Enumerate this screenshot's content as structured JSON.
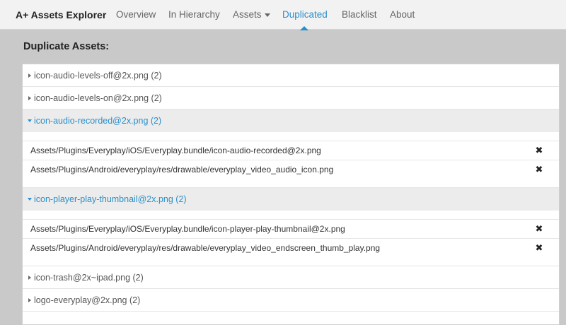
{
  "navbar": {
    "brand": "A+ Assets Explorer",
    "items": [
      {
        "label": "Overview"
      },
      {
        "label": "In Hierarchy"
      },
      {
        "label": "Assets"
      },
      {
        "label": "Duplicated"
      },
      {
        "label": "Blacklist"
      },
      {
        "label": "About"
      }
    ],
    "active_item": "Duplicated"
  },
  "page": {
    "title": "Duplicate Assets:"
  },
  "groups": [
    {
      "label": "icon-audio-levels-off@2x.png (2)",
      "expanded": false
    },
    {
      "label": "icon-audio-levels-on@2x.png (2)",
      "expanded": false
    },
    {
      "label": "icon-audio-recorded@2x.png (2)",
      "expanded": true,
      "paths": [
        "Assets/Plugins/Everyplay/iOS/Everyplay.bundle/icon-audio-recorded@2x.png",
        "Assets/Plugins/Android/everyplay/res/drawable/everyplay_video_audio_icon.png"
      ]
    },
    {
      "label": "icon-player-play-thumbnail@2x.png (2)",
      "expanded": true,
      "paths": [
        "Assets/Plugins/Everyplay/iOS/Everyplay.bundle/icon-player-play-thumbnail@2x.png",
        "Assets/Plugins/Android/everyplay/res/drawable/everyplay_video_endscreen_thumb_play.png"
      ]
    },
    {
      "label": "icon-trash@2x~ipad.png (2)",
      "expanded": false
    },
    {
      "label": "logo-everyplay@2x.png (2)",
      "expanded": false
    }
  ],
  "icons": {
    "delete": "✖",
    "delete_name": "close-icon"
  },
  "colors": {
    "accent": "#2b8fc9",
    "background": "#c9c9c9",
    "navbar": "#f2f2f2"
  }
}
